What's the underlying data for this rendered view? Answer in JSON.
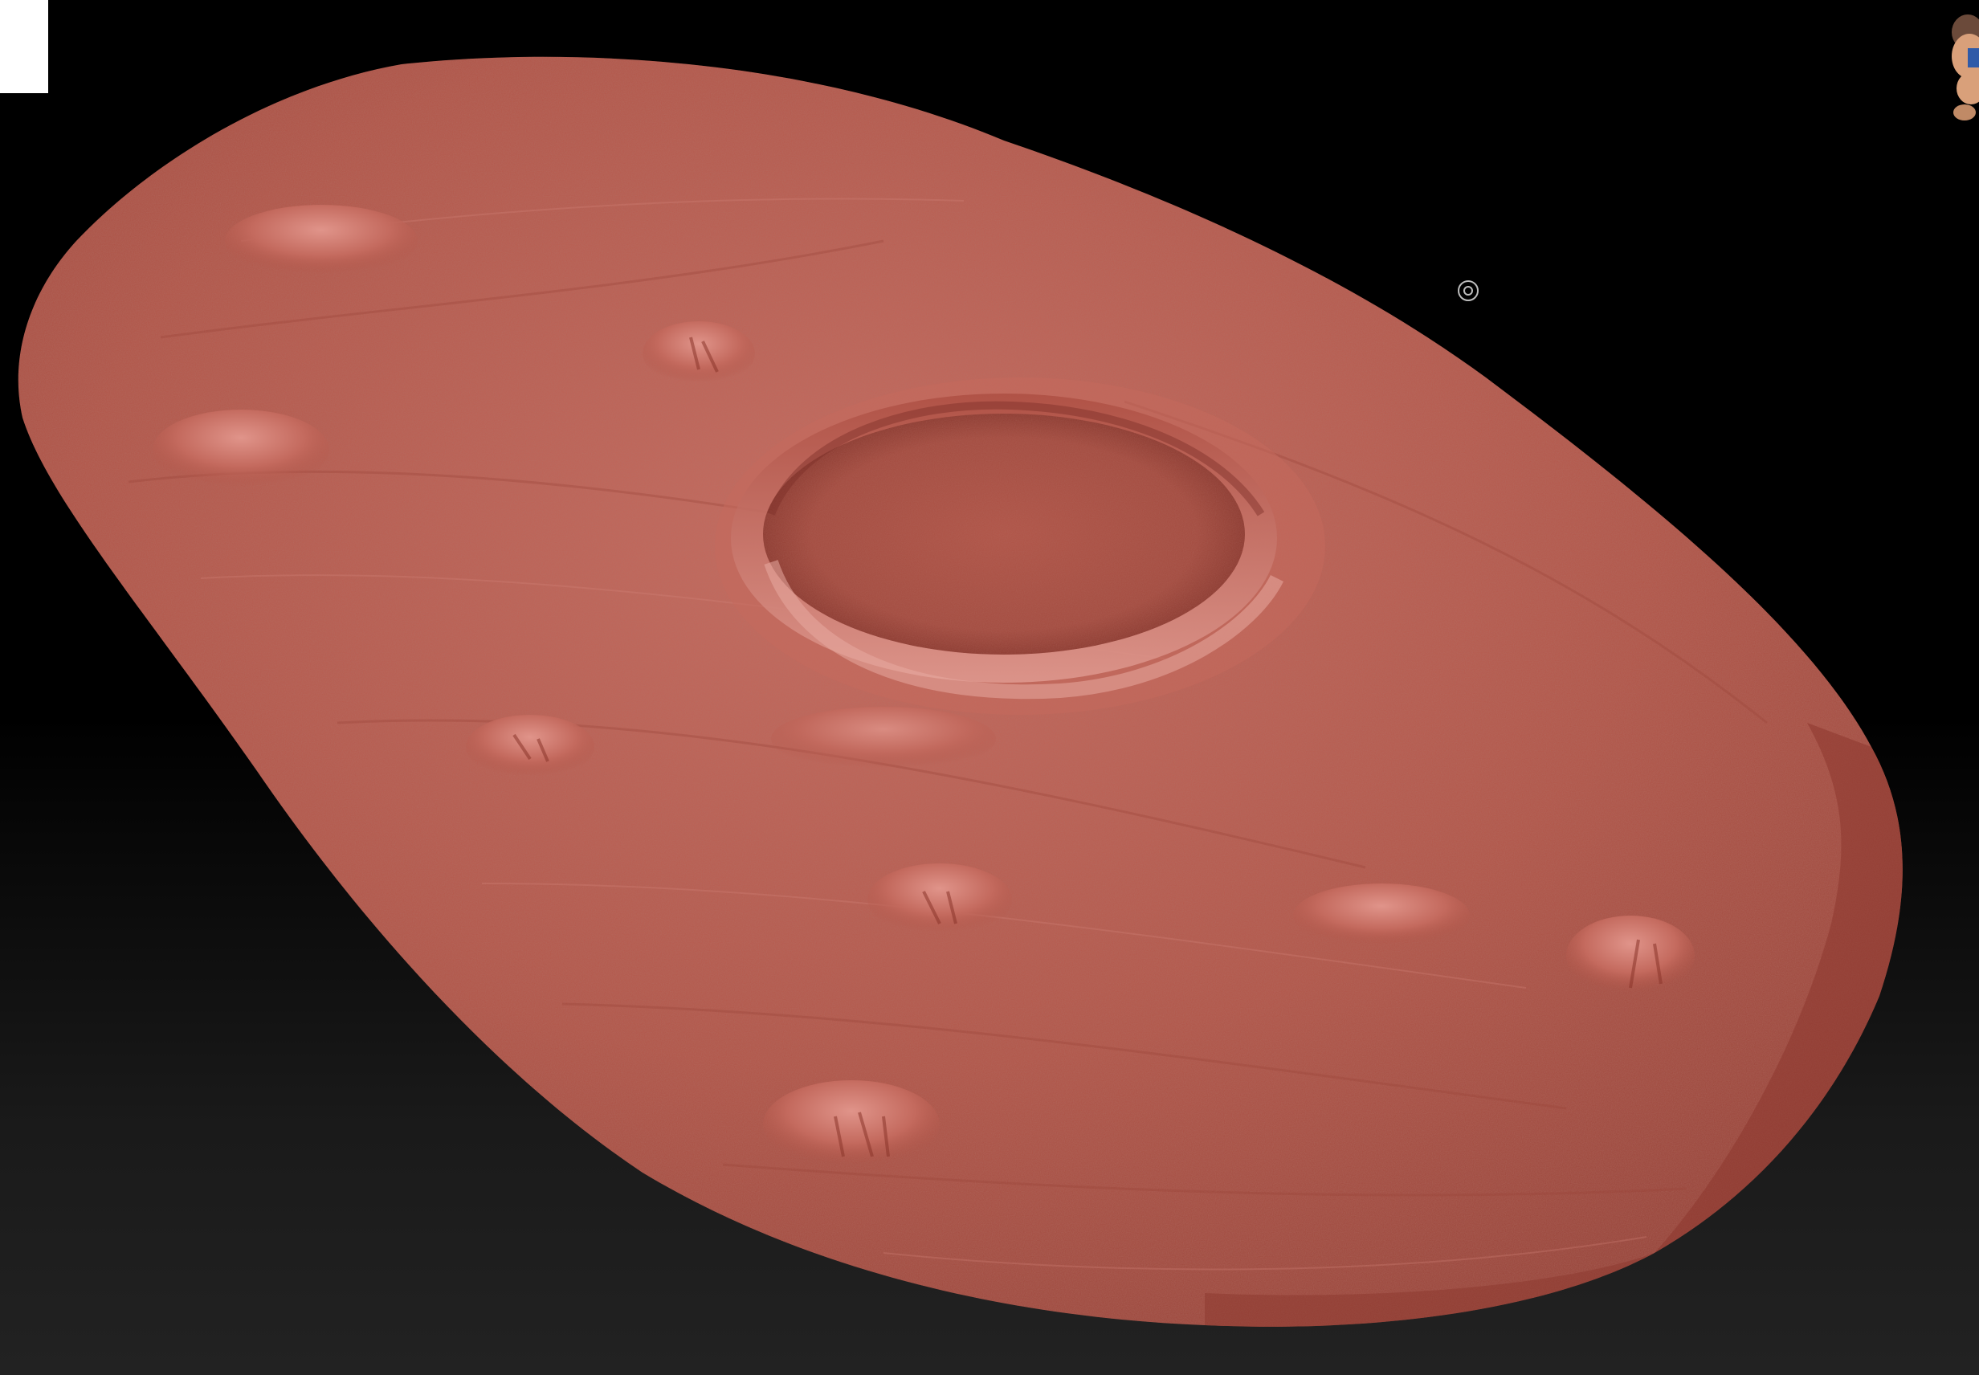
{
  "viewport": {
    "name": "3d-canvas",
    "background_top": "#000000",
    "background_bottom": "#222222"
  },
  "mesh": {
    "name": "terrain-mesh",
    "material_color": "#b7564a",
    "shadow_color": "#8f3a31",
    "highlight_color": "#d88a80",
    "features": [
      "crater",
      "mounds",
      "rough surface"
    ]
  },
  "icons": {
    "corner_tile": "corner-tile",
    "navigation_figure": "navigation-figure-icon",
    "pivot_marker": "pivot-marker-icon"
  }
}
